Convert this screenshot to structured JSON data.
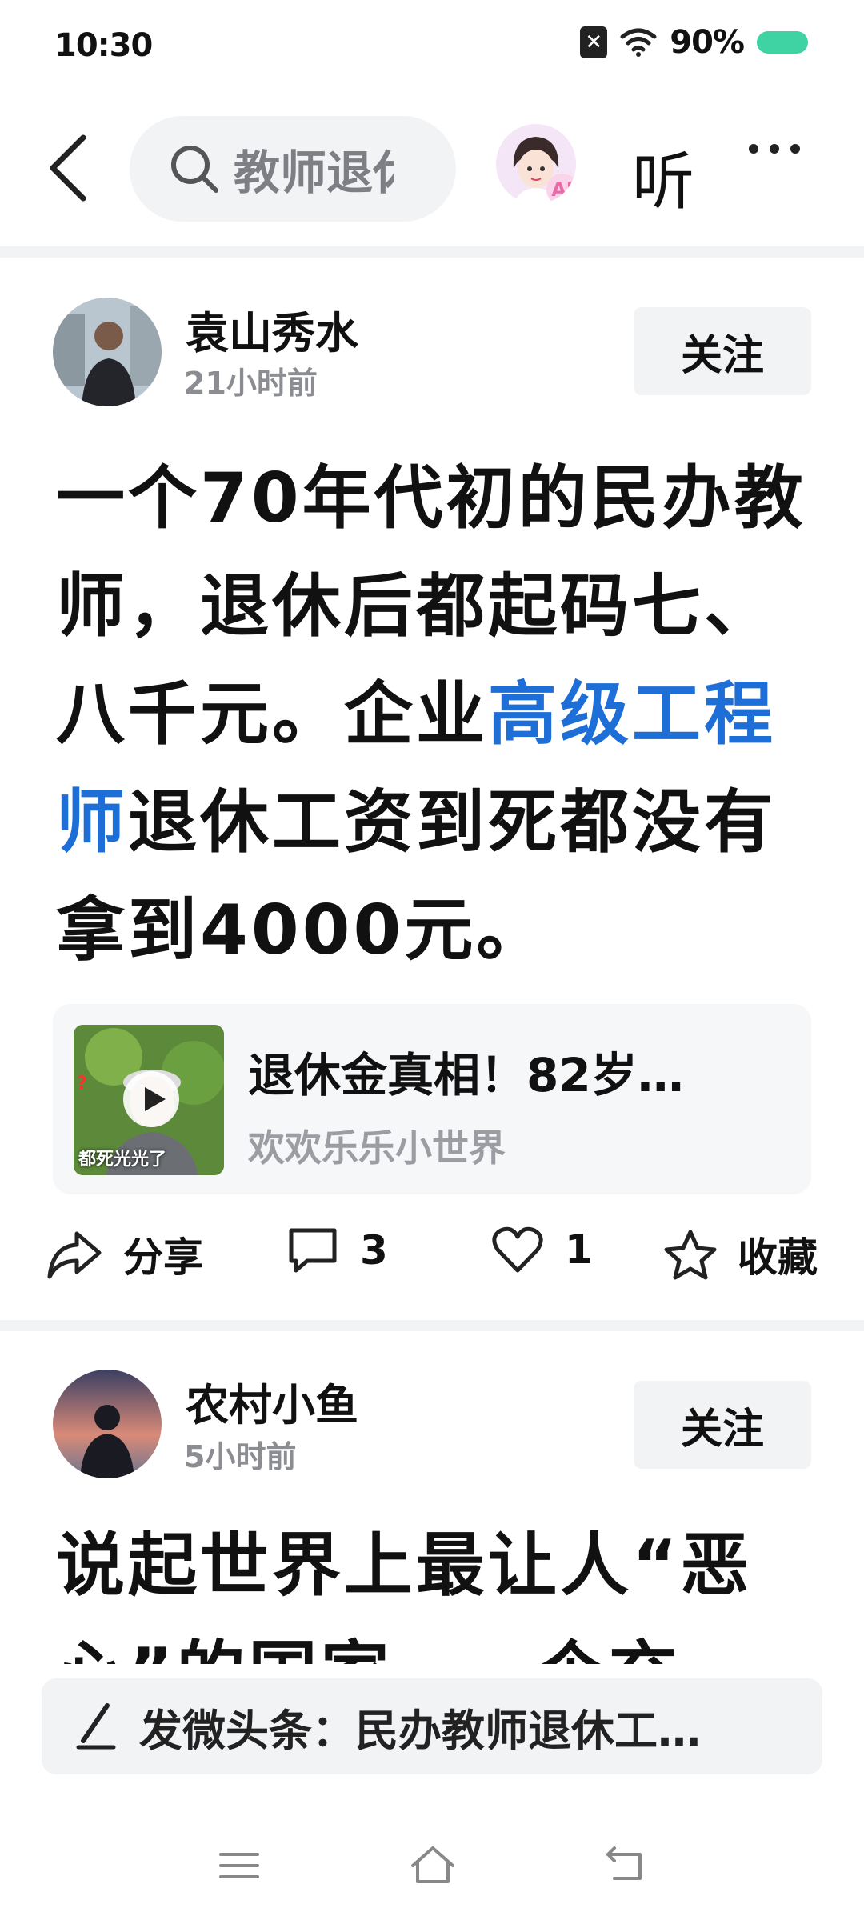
{
  "status_bar": {
    "time": "10:30",
    "battery": "90%"
  },
  "top_nav": {
    "search_text": "教师退休",
    "ai_badge": "AI",
    "listen_label": "听"
  },
  "posts": [
    {
      "author": "袁山秀水",
      "time": "21小时前",
      "follow_label": "关注",
      "title_parts": [
        "一个70年代初的民办教师，退休后都起码七、八千元。企业",
        "高级工程师",
        "退休工资到死都没有拿到4000元。"
      ],
      "video": {
        "title": "退休金真相！82岁…",
        "source": "欢欢乐乐小世界",
        "thumb_caption": "都死光光了"
      },
      "actions": {
        "share_label": "分享",
        "comment_count": "3",
        "like_count": "1",
        "favorite_label": "收藏"
      }
    },
    {
      "author": "农村小鱼",
      "time": "5小时前",
      "follow_label": "关注",
      "title": "说起世界上最让人“恶心”的国家，一个充"
    }
  ],
  "compose": {
    "text": "发微头条：民办教师退休工…"
  },
  "colors": {
    "accent": "#1e6ed8",
    "battery": "#3fd3a4"
  }
}
